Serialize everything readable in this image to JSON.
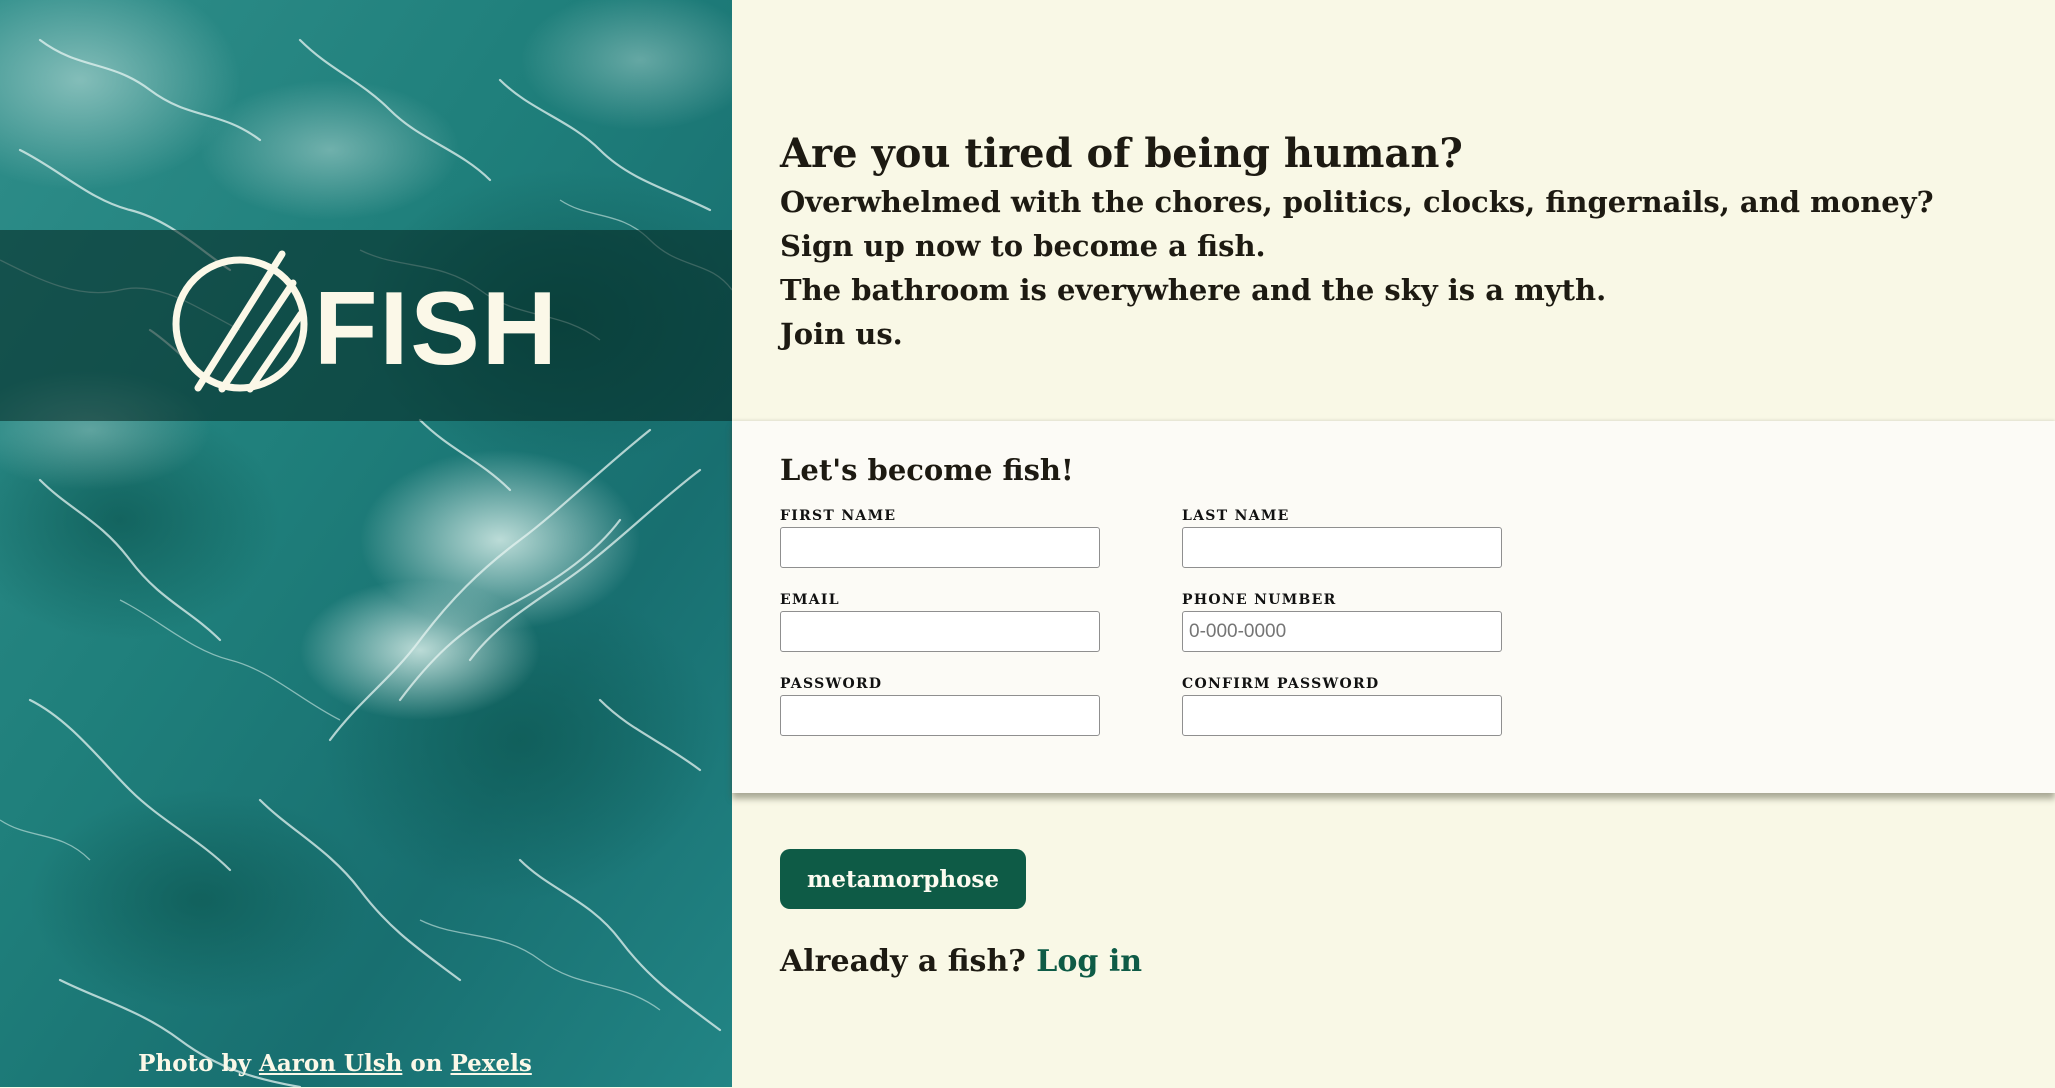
{
  "brand": {
    "logo_text": "FISH",
    "logo_name": "fish-logo"
  },
  "hero": {
    "credit_prefix": "Photo by",
    "credit_author": "Aaron Ulsh",
    "credit_mid": "on",
    "credit_site": "Pexels"
  },
  "intro": {
    "heading": "Are you tired of being human?",
    "lines": [
      "Overwhelmed with the chores, politics, clocks, fingernails, and money?",
      "Sign up now to become a fish.",
      "The bathroom is everywhere and the sky is a myth.",
      "Join us."
    ]
  },
  "form": {
    "title": "Let's become fish!",
    "first_name": {
      "label": "FIRST NAME",
      "value": "",
      "placeholder": ""
    },
    "last_name": {
      "label": "LAST NAME",
      "value": "",
      "placeholder": ""
    },
    "email": {
      "label": "EMAIL",
      "value": "",
      "placeholder": ""
    },
    "phone": {
      "label": "PHONE NUMBER",
      "value": "",
      "placeholder": "0-000-0000"
    },
    "password": {
      "label": "PASSWORD",
      "value": "",
      "placeholder": ""
    },
    "confirm_password": {
      "label": "CONFIRM PASSWORD",
      "value": "",
      "placeholder": ""
    },
    "submit_label": "metamorphose"
  },
  "login": {
    "prompt": "Already a fish?",
    "link_label": "Log in"
  },
  "colors": {
    "background": "#f9f8e6",
    "panel": "#fcfbf6",
    "accent": "#0e5b46",
    "sea": "#1b7a78",
    "logo": "#fbf8e8"
  }
}
